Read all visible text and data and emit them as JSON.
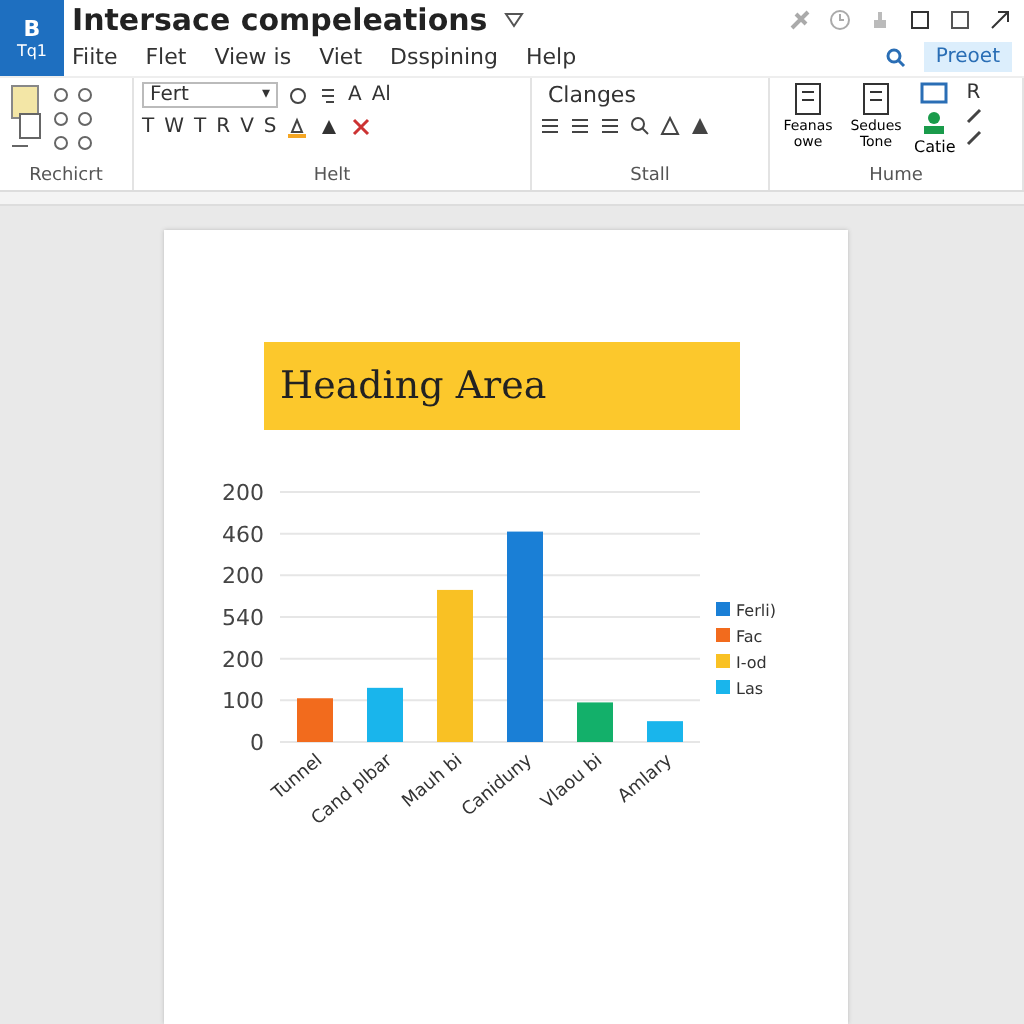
{
  "window": {
    "title": "Intersace compeleations",
    "app_badge": "B",
    "app_label": "Tq1"
  },
  "menu": [
    {
      "label": "Fiite"
    },
    {
      "label": "Flet"
    },
    {
      "label": "View is"
    },
    {
      "label": "Viet"
    },
    {
      "label": "Dsspining"
    },
    {
      "label": "Help"
    }
  ],
  "share_button": "Preoet",
  "ribbon": {
    "groups": [
      {
        "label": "Rechicrt"
      },
      {
        "label": "Helt",
        "font_box": "Fert",
        "font_caret": "▾",
        "row1": [
          "A",
          "Al"
        ],
        "row2": [
          "T",
          "W",
          "T",
          "R",
          "V",
          "S"
        ]
      },
      {
        "label": "Stall",
        "style_box": "Clanges"
      },
      {
        "label": "Hume",
        "big_buttons": [
          "Feanas owe",
          "Sedues Tone"
        ],
        "small_button": "Catie",
        "side_letter": "R"
      }
    ]
  },
  "document": {
    "heading": "Heading Area",
    "upper_axis_labels": [
      "200",
      "460",
      "200",
      "540"
    ],
    "chart_data": {
      "type": "bar",
      "categories": [
        "Tunnel",
        "Cand plbar",
        "Mauh bi",
        "Caniduny",
        "Vlaou bi",
        "Amlary"
      ],
      "ylim": [
        0,
        600
      ],
      "grid": true,
      "legend": true,
      "yticks": [
        {
          "value": 0,
          "label": "0"
        },
        {
          "value": 100,
          "label": "100"
        },
        200
      ],
      "series": [
        {
          "name": "Ferli)",
          "color": "#1a7fd6",
          "values": [
            null,
            null,
            null,
            505,
            null,
            null
          ]
        },
        {
          "name": "Fac",
          "color": "#f26b1d",
          "values": [
            105,
            null,
            null,
            null,
            null,
            null
          ]
        },
        {
          "name": "I-od",
          "color": "#f9c124",
          "values": [
            null,
            null,
            365,
            null,
            null,
            null
          ]
        },
        {
          "name": "Las",
          "color": "#19b5ec",
          "values": [
            null,
            130,
            null,
            null,
            null,
            50
          ]
        },
        {
          "color": "#13b06a",
          "values": [
            null,
            null,
            null,
            null,
            95,
            null
          ]
        }
      ]
    }
  }
}
